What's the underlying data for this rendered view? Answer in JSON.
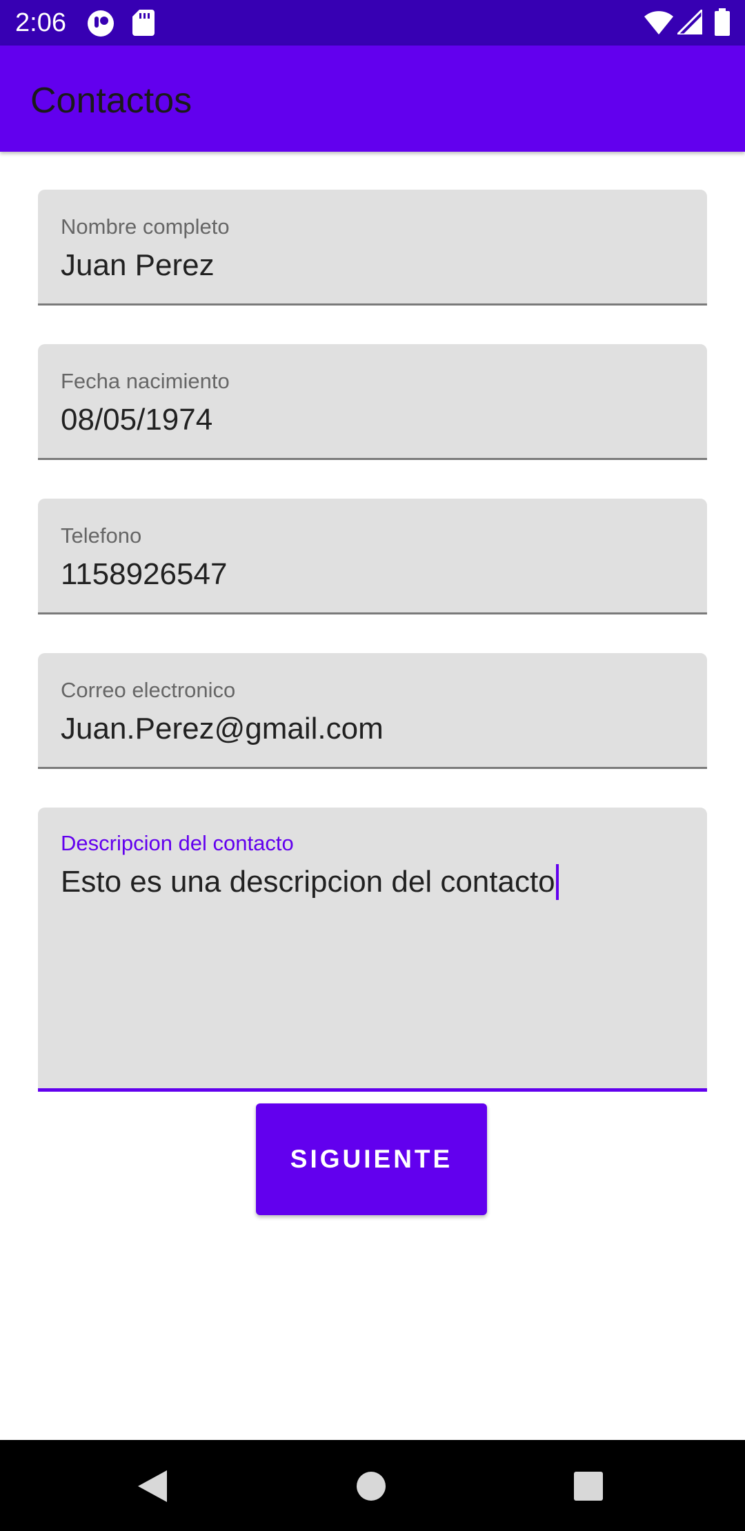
{
  "status_bar": {
    "time": "2:06",
    "icons": [
      "app-notification-icon",
      "sd-card-icon",
      "wifi-icon",
      "cell-signal-icon",
      "battery-icon"
    ]
  },
  "app_bar": {
    "title": "Contactos"
  },
  "form": {
    "fields": [
      {
        "label": "Nombre completo",
        "value": "Juan Perez"
      },
      {
        "label": "Fecha nacimiento",
        "value": "08/05/1974"
      },
      {
        "label": "Telefono",
        "value": "1158926547"
      },
      {
        "label": "Correo electronico",
        "value": "Juan.Perez@gmail.com"
      },
      {
        "label": "Descripcion del contacto",
        "value": "Esto es una descripcion del contacto"
      }
    ],
    "next_button": "SIGUIENTE"
  },
  "nav_bar": {
    "icons": [
      "back-icon",
      "home-icon",
      "recents-icon"
    ]
  },
  "colors": {
    "status_bar": "#3700b3",
    "primary": "#6200ee",
    "field_background": "#e0e0e0",
    "field_underline": "#7a7a7a",
    "nav_bar": "#000000"
  }
}
